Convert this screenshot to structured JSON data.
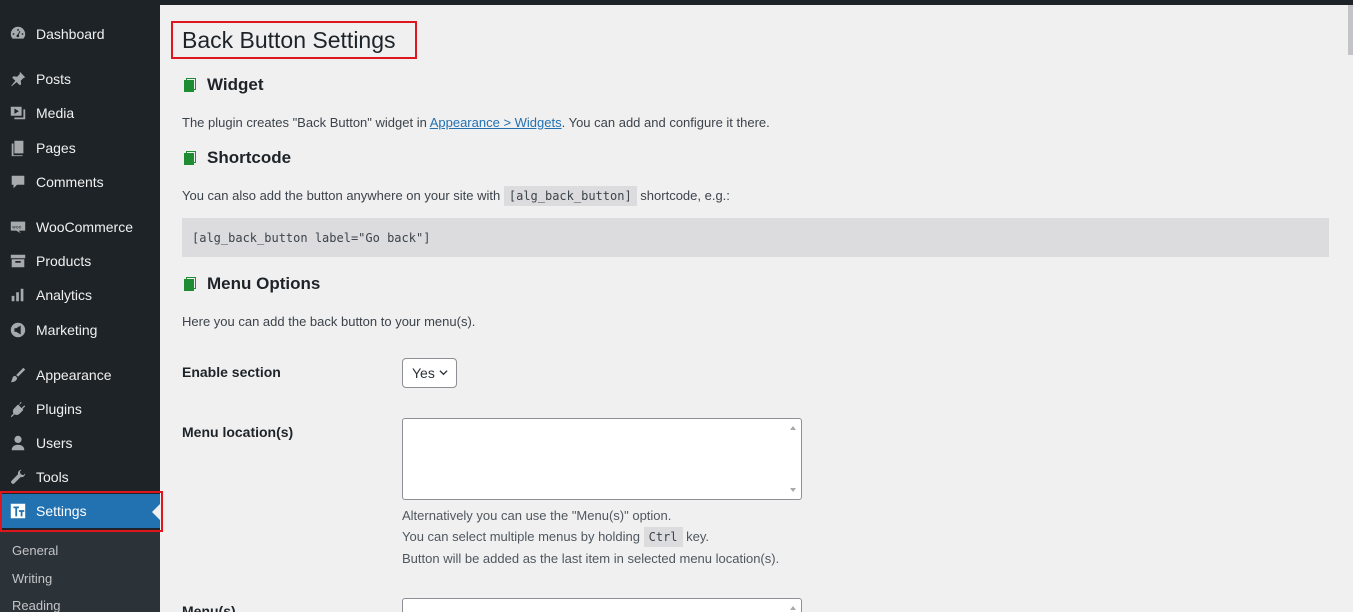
{
  "sidebar": {
    "items": [
      {
        "label": "Dashboard",
        "icon": "dashboard-icon"
      },
      {
        "label": "Posts",
        "icon": "pin-icon"
      },
      {
        "label": "Media",
        "icon": "media-icon"
      },
      {
        "label": "Pages",
        "icon": "pages-icon"
      },
      {
        "label": "Comments",
        "icon": "comment-icon"
      },
      {
        "label": "WooCommerce",
        "icon": "woo-icon"
      },
      {
        "label": "Products",
        "icon": "archive-icon"
      },
      {
        "label": "Analytics",
        "icon": "bar-chart-icon"
      },
      {
        "label": "Marketing",
        "icon": "megaphone-icon"
      },
      {
        "label": "Appearance",
        "icon": "brush-icon"
      },
      {
        "label": "Plugins",
        "icon": "plug-icon"
      },
      {
        "label": "Users",
        "icon": "user-icon"
      },
      {
        "label": "Tools",
        "icon": "wrench-icon"
      },
      {
        "label": "Settings",
        "icon": "settings-icon"
      }
    ],
    "submenu": [
      "General",
      "Writing",
      "Reading"
    ]
  },
  "page": {
    "title": "Back Button Settings",
    "widget": {
      "heading": "Widget",
      "desc_before": "The plugin creates \"Back Button\" widget in ",
      "link": "Appearance > Widgets",
      "desc_after": ". You can add and configure it there."
    },
    "shortcode": {
      "heading": "Shortcode",
      "desc_before": "You can also add the button anywhere on your site with ",
      "code": "[alg_back_button]",
      "desc_after": " shortcode, e.g.:",
      "example": "[alg_back_button label=\"Go back\"]"
    },
    "menu": {
      "heading": "Menu Options",
      "desc": "Here you can add the back button to your menu(s).",
      "enable_label": "Enable section",
      "enable_value": "Yes",
      "location_label": "Menu location(s)",
      "help1": "Alternatively you can use the \"Menu(s)\" option.",
      "help2_before": "You can select multiple menus by holding ",
      "help2_code": "Ctrl",
      "help2_after": " key.",
      "help3": "Button will be added as the last item in selected menu location(s).",
      "menus_label": "Menu(s)"
    }
  },
  "colors": {
    "sidebar_bg": "#1d2327",
    "active": "#2271b1",
    "highlight": "#e0161e",
    "book_icon": "#1e8c32"
  }
}
